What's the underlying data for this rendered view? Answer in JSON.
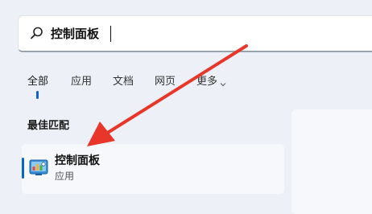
{
  "search": {
    "query": "控制面板"
  },
  "tabs": [
    {
      "label": "全部",
      "active": true
    },
    {
      "label": "应用",
      "active": false
    },
    {
      "label": "文档",
      "active": false
    },
    {
      "label": "网页",
      "active": false
    },
    {
      "label": "更多",
      "active": false
    }
  ],
  "results": {
    "section_title": "最佳匹配",
    "best_match": {
      "title": "控制面板",
      "subtitle": "应用",
      "icon": "control-panel-icon"
    }
  },
  "colors": {
    "accent": "#0b62c9",
    "annotation": "#e8362a"
  }
}
